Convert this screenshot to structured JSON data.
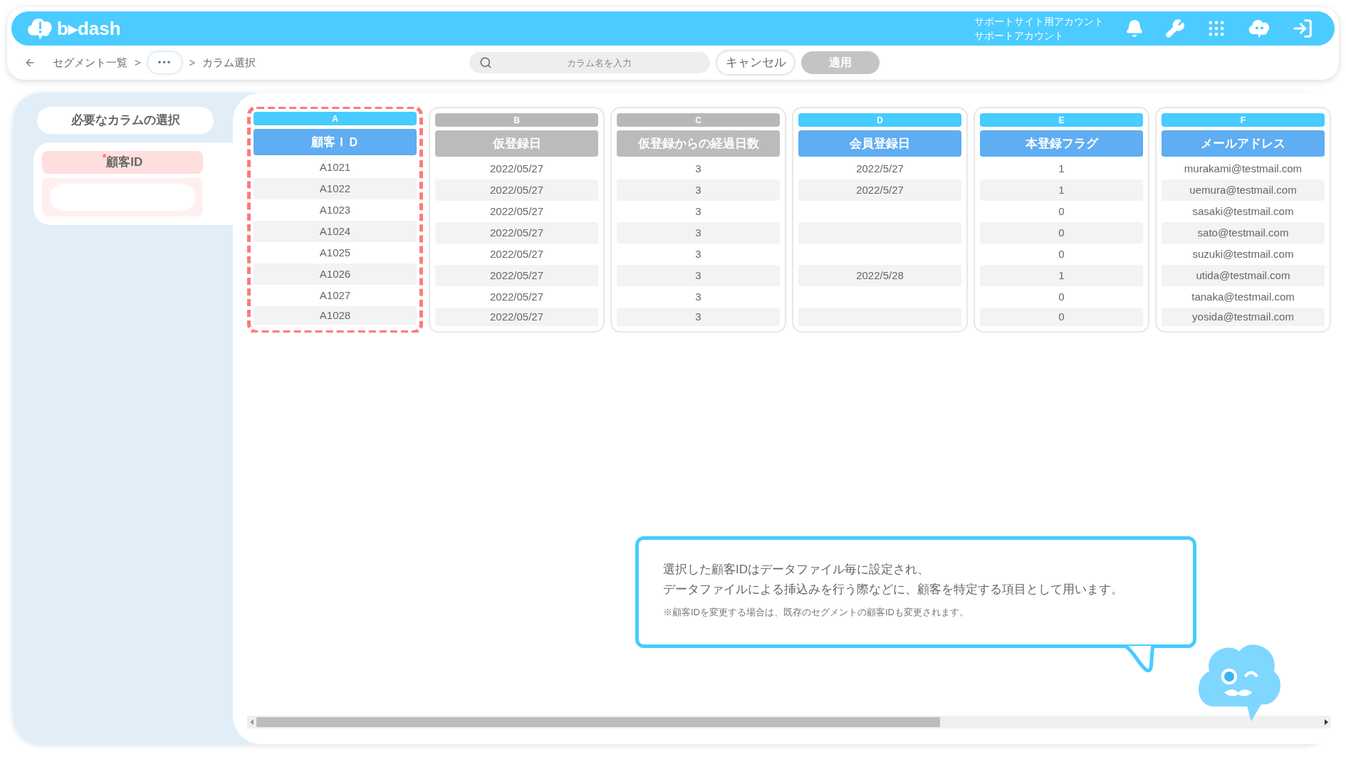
{
  "header": {
    "logo_text": "b▸dash",
    "account": [
      "サポートサイト用アカウント",
      "サポートアカウント"
    ]
  },
  "breadcrumb": [
    {
      "kind": "link",
      "text": "セグメント一覧"
    },
    {
      "kind": "sep",
      "text": ">"
    },
    {
      "kind": "more",
      "text": "•••"
    },
    {
      "kind": "sep",
      "text": ">"
    },
    {
      "kind": "current",
      "text": "カラム選択"
    }
  ],
  "search": {
    "placeholder": "カラム名を入力"
  },
  "buttons": [
    {
      "label": "キャンセル",
      "disabled": false
    },
    {
      "label": "適用",
      "disabled": true
    }
  ],
  "sidebar": {
    "title": "必要なカラムの選択",
    "fields": [
      {
        "label": "$^{*}$顧客ID"
      }
    ]
  },
  "columns": [
    {
      "letter": "A",
      "title": "顧客ＩＤ",
      "selected": true,
      "highlighted": true,
      "cells": [
        "A1021",
        "A1022",
        "A1023",
        "A1024",
        "A1025",
        "A1026",
        "A1027",
        "A1028"
      ]
    },
    {
      "letter": "B",
      "title": "仮登録日",
      "selected": false,
      "highlighted": false,
      "cells": [
        "2022/05/27",
        "2022/05/27",
        "2022/05/27",
        "2022/05/27",
        "2022/05/27",
        "2022/05/27",
        "2022/05/27",
        "2022/05/27"
      ]
    },
    {
      "letter": "C",
      "title": "仮登録からの経過日数",
      "selected": false,
      "highlighted": false,
      "cells": [
        "3",
        "3",
        "3",
        "3",
        "3",
        "3",
        "3",
        "3"
      ]
    },
    {
      "letter": "D",
      "title": "会員登録日",
      "selected": true,
      "highlighted": false,
      "cells": [
        "2022/5/27",
        "2022/5/27",
        null,
        null,
        null,
        "2022/5/28",
        null,
        null
      ]
    },
    {
      "letter": "E",
      "title": "本登録フラグ",
      "selected": true,
      "highlighted": false,
      "cells": [
        "1",
        "1",
        "0",
        "0",
        "0",
        "1",
        "0",
        "0"
      ]
    },
    {
      "letter": "F",
      "title": "メールアドレス",
      "selected": true,
      "highlighted": false,
      "cells": [
        "murakami@testmail.com",
        "uemura@testmail.com",
        "sasaki@testmail.com",
        "sato@testmail.com",
        "suzuki@testmail.com",
        "utida@testmail.com",
        "tanaka@testmail.com",
        "yosida@testmail.com"
      ]
    }
  ],
  "tooltip": {
    "lines": [
      "選択した顧客IDはデータファイル毎に設定され、",
      "データファイルによる挿込みを行う際などに、顧客を特定する項目として用います。"
    ],
    "note": "※顧客IDを変更する場合は、既存のセグメントの顧客IDも変更されます。"
  }
}
